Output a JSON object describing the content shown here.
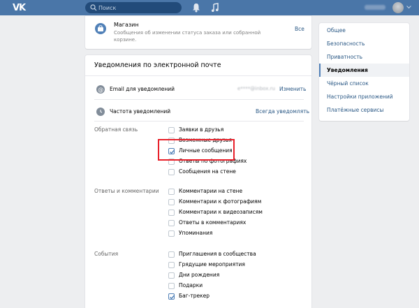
{
  "header": {
    "logo": "VK",
    "search_placeholder": "Поиск",
    "bell_icon": "bell-icon",
    "music_icon": "music-icon"
  },
  "store": {
    "title": "Магазин",
    "description": "Сообщения об изменении статуса заказа или собранной корзине.",
    "all_link": "Все"
  },
  "email_notifications": {
    "title": "Уведомления по электронной почте",
    "email_label": "Email для уведомлений",
    "email_value": "e****@inbox.ru",
    "email_action": "Изменить",
    "frequency_label": "Частота уведомлений",
    "frequency_value": "Всегда уведомлять",
    "groups": [
      {
        "label": "Обратная связь",
        "options": [
          {
            "label": "Заявки в друзья",
            "checked": false
          },
          {
            "label": "Возможные друзья",
            "checked": false
          },
          {
            "label": "Личные сообщения",
            "checked": true
          },
          {
            "label": "Ответы по фотографиях",
            "checked": false
          },
          {
            "label": "Сообщения на стене",
            "checked": false
          }
        ]
      },
      {
        "label": "Ответы и комментарии",
        "options": [
          {
            "label": "Комментарии на стене",
            "checked": false
          },
          {
            "label": "Комментарии к фотографиям",
            "checked": false
          },
          {
            "label": "Комментарии к видеозаписям",
            "checked": false
          },
          {
            "label": "Ответы в комментариях",
            "checked": false
          },
          {
            "label": "Упоминания",
            "checked": false
          }
        ]
      },
      {
        "label": "События",
        "options": [
          {
            "label": "Приглашения в сообщества",
            "checked": false
          },
          {
            "label": "Грядущие мероприятия",
            "checked": false
          },
          {
            "label": "Дни рождения",
            "checked": false
          },
          {
            "label": "Подарки",
            "checked": false
          },
          {
            "label": "Баг-трекер",
            "checked": true
          }
        ]
      }
    ]
  },
  "menu": {
    "items": [
      {
        "label": "Общее",
        "active": false
      },
      {
        "label": "Безопасность",
        "active": false
      },
      {
        "label": "Приватность",
        "active": false
      },
      {
        "label": "Уведомления",
        "active": true
      },
      {
        "label": "Чёрный список",
        "active": false
      },
      {
        "label": "Настройки приложений",
        "active": false
      },
      {
        "label": "Платёжные сервисы",
        "active": false
      }
    ]
  },
  "colors": {
    "header": "#4a76a8",
    "link": "#2a5885",
    "highlight": "#e8202a",
    "background": "#edeef0"
  }
}
